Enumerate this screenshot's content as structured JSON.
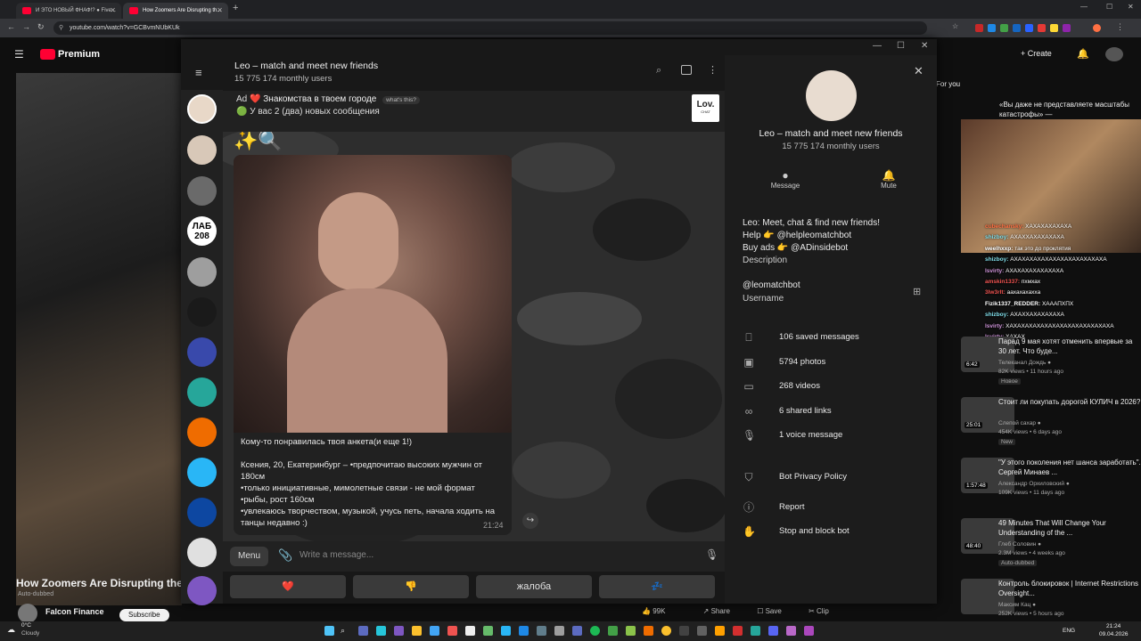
{
  "browser": {
    "tabs": [
      {
        "label": "И ЭТО НОВЫЙ ФНАФ!? ● Five..."
      },
      {
        "label": "How Zoomers Are Disrupting th..."
      }
    ],
    "url": "youtube.com/watch?v=GCBvmNUbKUk"
  },
  "youtube": {
    "logo": "Premium",
    "create": "Create",
    "for_you": "For you",
    "video_title": "How Zoomers Are Disrupting the",
    "autodub": "Auto-dubbed",
    "channel": "Falcon Finance",
    "subscribe": "Subscribe",
    "actions": {
      "likes": "99K",
      "share": "Share",
      "save": "Save",
      "clip": "Clip"
    },
    "chat_header": "«Вы даже не представляете масштабы катастрофы» —",
    "chat": [
      {
        "user": "cubechansky:",
        "text": "ХАХАХАХАХАХА",
        "color": "#ff7043"
      },
      {
        "user": "shizboy:",
        "text": "АХАХХАХАХАХАХА",
        "color": "#80deea"
      },
      {
        "user": "weelhxxp:",
        "text": "так это до проклятия",
        "color": "#ffffff"
      },
      {
        "user": "shizboy:",
        "text": "АХАХАХАХАХАХАХАХАХАХАХАХА",
        "color": "#80deea"
      },
      {
        "user": "lsvirty:",
        "text": "АХАХАХАХАХАХАХА",
        "color": "#ce93d8"
      },
      {
        "user": "amskin1337:",
        "text": "пхмхах",
        "color": "#ef5350"
      },
      {
        "user": "3lw3rlt:",
        "text": "аахахахахха",
        "color": "#ef5350"
      },
      {
        "user": "Fizik1337_REDDER:",
        "text": "ХАААПХПХ",
        "color": "#ffffff"
      },
      {
        "user": "shizboy:",
        "text": "АХАХХАХАХАХАХА",
        "color": "#80deea"
      },
      {
        "user": "lsvirty:",
        "text": "ХАХАХАХАХАХАХАХАХАХАХАХАХАХА",
        "color": "#ce93d8"
      },
      {
        "user": "lsvirty:",
        "text": "ХАХАХ",
        "color": "#ce93d8"
      }
    ],
    "recs": [
      {
        "title": "Парад 9 мая хотят отменить впервые за 30 лет. Что буде...",
        "channel": "Телеканал Дождь ●",
        "meta": "82K views • 11 hours ago",
        "badge": "Новое",
        "dur": "6:42"
      },
      {
        "title": "Стоит ли покупать дорогой КУЛИЧ в 2026?",
        "channel": "Слепой сахар ●",
        "meta": "454K views • 6 days ago",
        "badge": "New",
        "dur": "25:01"
      },
      {
        "title": "\"У этого поколения нет шанса заработать\". Сергей Минаев ...",
        "channel": "Александр Орхиловский ●",
        "meta": "109K views • 11 days ago",
        "badge": "",
        "dur": "1:57:48"
      },
      {
        "title": "49 Minutes That Will Change Your Understanding of the ...",
        "channel": "Глеб Соловин ●",
        "meta": "2.3M views • 4 weeks ago",
        "badge": "Auto-dubbed",
        "dur": "48:40"
      },
      {
        "title": "Контроль блокировок | Internet Restrictions Oversight...",
        "channel": "Максим Кац ●",
        "meta": "252K views • 5 hours ago",
        "badge": "",
        "dur": ""
      }
    ]
  },
  "telegram": {
    "header": {
      "title": "Leo – match and meet new friends",
      "subtitle": "15 775 174 monthly users"
    },
    "pinned": {
      "ad_label": "Ad",
      "heart": "❤️",
      "ad_title": "Знакомства в твоем городе",
      "whats_this": "what's this?",
      "ad_text": "🟢 У вас 2 (два) новых сообщения",
      "logo_text": "Lov.",
      "logo_sub": "CHAT"
    },
    "message": {
      "emoji_line": "✨🔍",
      "line1": "Кому-то понравилась твоя анкета(и еще 1!)",
      "line2": "Ксения, 20, Екатеринбург – •предпочитаю высоких мужчин от 180см",
      "line3": "•только инициативные, мимолетные связи - не мой формат",
      "line4": "•рыбы, рост 160см",
      "line5": "•увлекаюсь творчеством, музыкой, учусь петь, начала ходить на танцы недавно :)",
      "time": "21:24"
    },
    "input": {
      "menu": "Menu",
      "placeholder": "Write a message..."
    },
    "keyboard": [
      {
        "label": "❤️"
      },
      {
        "label": "👎"
      },
      {
        "label": "жалоба"
      },
      {
        "label": "💤"
      }
    ],
    "rail_badges": [
      "ЛАБ 208"
    ],
    "info": {
      "title": "Leo – match and meet new friends",
      "subtitle": "15 775 174 monthly users",
      "message_btn": "Message",
      "mute_btn": "Mute",
      "bio1": "Leo: Meet, chat & find new friends!",
      "bio2": "Help 👉 @helpleomatchbot",
      "bio3": "Buy ads 👉 @ADinsidebot",
      "bio_label": "Description",
      "username": "@leomatchbot",
      "username_label": "Username",
      "media": [
        {
          "icon": "bookmark-icon",
          "text": "106 saved messages"
        },
        {
          "icon": "photo-icon",
          "text": "5794 photos"
        },
        {
          "icon": "video-icon",
          "text": "268 videos"
        },
        {
          "icon": "link-icon",
          "text": "6 shared links"
        },
        {
          "icon": "mic-icon",
          "text": "1 voice message"
        }
      ],
      "privacy": "Bot Privacy Policy",
      "report": "Report",
      "stop": "Stop and block bot"
    }
  },
  "taskbar": {
    "weather_temp": "0°C",
    "weather_text": "Cloudy",
    "lang": "ENG",
    "time": "21:24",
    "date": "09.04.2026"
  }
}
